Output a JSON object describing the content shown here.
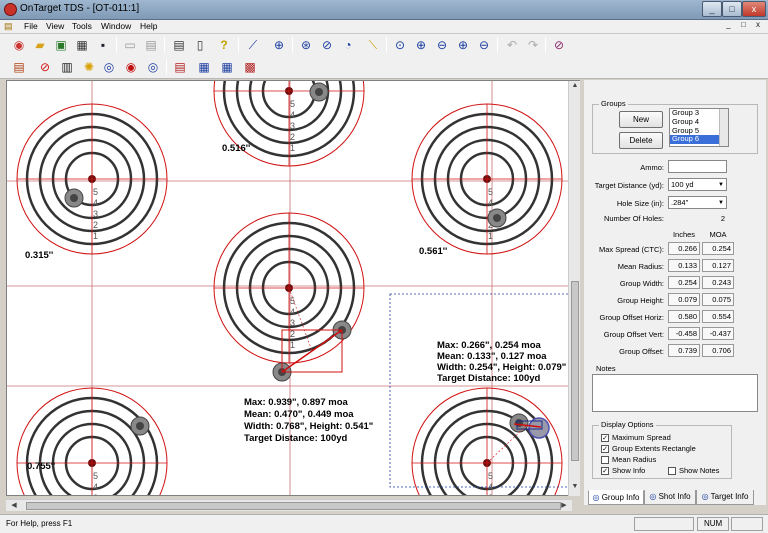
{
  "window": {
    "title": "OnTarget TDS - [OT-011:1]",
    "min": "_",
    "max": "□",
    "close": "x"
  },
  "menu": [
    "File",
    "View",
    "Tools",
    "Window",
    "Help"
  ],
  "toolbar1": [
    "new",
    "open",
    "image",
    "print-setup",
    "save",
    "copy",
    "paste",
    "print",
    "preview",
    "help",
    "ruler-line",
    "crosshair",
    "group",
    "rotate",
    "zoom-fit",
    "measure",
    "zoom-in",
    "zoom-in-plus",
    "zoom-out",
    "zoom-in2",
    "zoom-out2",
    "undo",
    "redo",
    "hide"
  ],
  "toolbar2": [
    "book",
    "no",
    "barcode",
    "sun",
    "sight-1",
    "sight-2",
    "sight-3",
    "export",
    "report-1",
    "report-2",
    "print-2"
  ],
  "status": {
    "help": "For Help, press F1",
    "num": "NUM"
  },
  "groups": {
    "title": "Groups",
    "list": [
      "Group 3",
      "Group 4",
      "Group 5",
      "Group 6"
    ],
    "selected": "Group 6",
    "new": "New",
    "delete": "Delete"
  },
  "fields": {
    "ammo_label": "Ammo:",
    "ammo_value": "",
    "distance_label": "Target Distance (yd):",
    "distance_value": "100 yd",
    "hole_label": "Hole Size (in):",
    "hole_value": ".284\"",
    "holes_label": "Number Of Holes:",
    "holes_value": "2"
  },
  "stats": {
    "col_inches": "Inches",
    "col_moa": "MOA",
    "rows": [
      {
        "label": "Max Spread (CTC):",
        "inches": "0.266",
        "moa": "0.254"
      },
      {
        "label": "Mean Radius:",
        "inches": "0.133",
        "moa": "0.127"
      },
      {
        "label": "Group Width:",
        "inches": "0.254",
        "moa": "0.243"
      },
      {
        "label": "Group Height:",
        "inches": "0.079",
        "moa": "0.075"
      },
      {
        "label": "Group Offset Horiz:",
        "inches": "0.580",
        "moa": "0.554"
      },
      {
        "label": "Group Offset Vert:",
        "inches": "-0.458",
        "moa": "-0.437"
      },
      {
        "label": "Group Offset:",
        "inches": "0.739",
        "moa": "0.706"
      }
    ]
  },
  "notes_label": "Notes",
  "display": {
    "title": "Display Options",
    "max_spread": "Maximum Spread",
    "extents": "Group Extents Rectangle",
    "mean_radius": "Mean Radius",
    "show_info": "Show Info",
    "show_notes": "Show Notes"
  },
  "tabs": [
    "Group Info",
    "Shot Info",
    "Target Info"
  ],
  "targets": {
    "t1": "0.516''",
    "t2": "0.315''",
    "t3": "0.561''",
    "t4": "0.755''",
    "center_info": [
      "Max: 0.939\", 0.897 moa",
      "Mean: 0.470\", 0.449 moa",
      "Width: 0.768\", Height: 0.541\"",
      "Target Distance: 100yd"
    ],
    "right_info": [
      "Max: 0.266\", 0.254 moa",
      "Mean: 0.133\", 0.127 moa",
      "Width: 0.254\", Height: 0.079\"",
      "Target Distance: 100yd"
    ]
  },
  "ring_numbers": [
    "5",
    "4",
    "3",
    "2",
    "1"
  ],
  "colors": {
    "ring_red": "#d01010",
    "grid": "#c87070"
  }
}
